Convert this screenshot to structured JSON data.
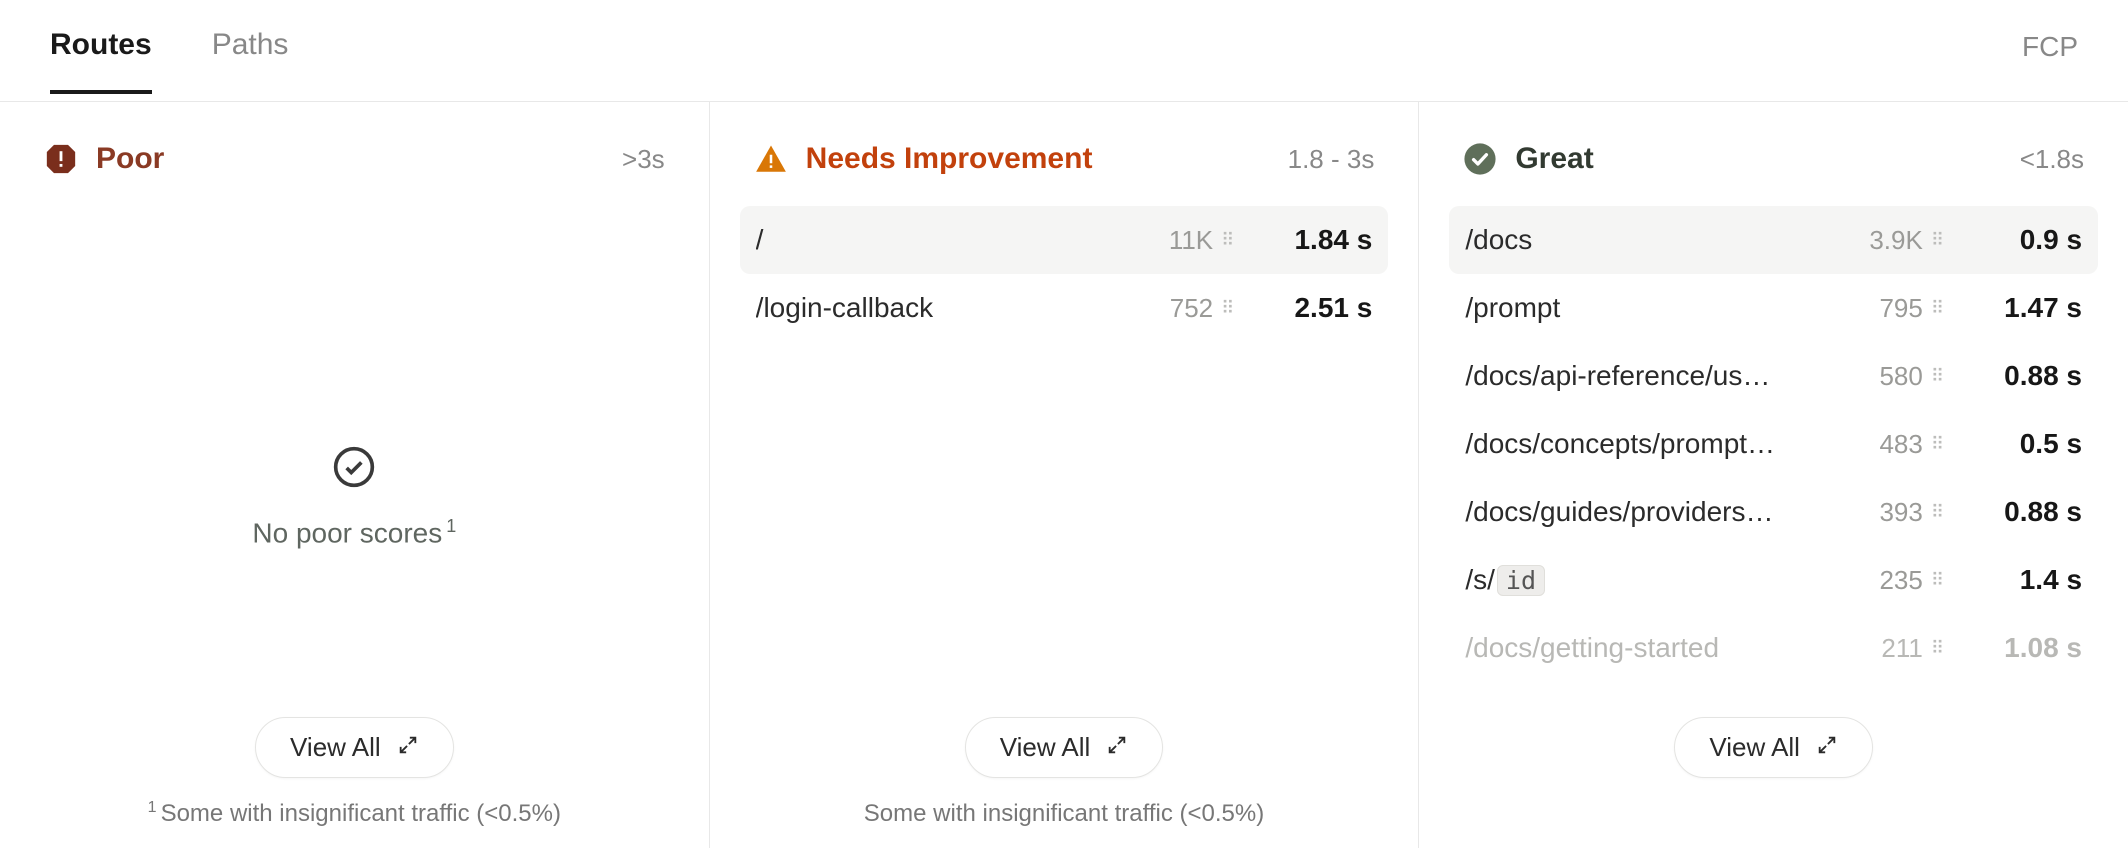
{
  "tabs": {
    "routes": "Routes",
    "paths": "Paths",
    "metric": "FCP"
  },
  "columns": {
    "poor": {
      "title": "Poor",
      "range": ">3s",
      "empty": "No poor scores",
      "empty_sup": "1",
      "viewall": "View All",
      "footnote_sup": "1",
      "footnote": "Some with insignificant traffic (<0.5%)"
    },
    "needs": {
      "title": "Needs Improvement",
      "range": "1.8 - 3s",
      "viewall": "View All",
      "footnote": "Some with insignificant traffic (<0.5%)",
      "rows": [
        {
          "path": "/",
          "count": "11K",
          "time": "1.84 s"
        },
        {
          "path": "/login-callback",
          "count": "752",
          "time": "2.51 s"
        }
      ]
    },
    "great": {
      "title": "Great",
      "range": "<1.8s",
      "viewall": "View All",
      "rows": [
        {
          "path": "/docs",
          "count": "3.9K",
          "time": "0.9 s"
        },
        {
          "path": "/prompt",
          "count": "795",
          "time": "1.47 s"
        },
        {
          "path": "/docs/api-reference/us…",
          "count": "580",
          "time": "0.88 s"
        },
        {
          "path": "/docs/concepts/prompt…",
          "count": "483",
          "time": "0.5 s"
        },
        {
          "path": "/docs/guides/providers…",
          "count": "393",
          "time": "0.88 s"
        },
        {
          "path_prefix": "/s/",
          "path_chip": "id",
          "count": "235",
          "time": "1.4 s"
        },
        {
          "path": "/docs/getting-started",
          "count": "211",
          "time": "1.08 s",
          "faded": true
        }
      ]
    }
  }
}
